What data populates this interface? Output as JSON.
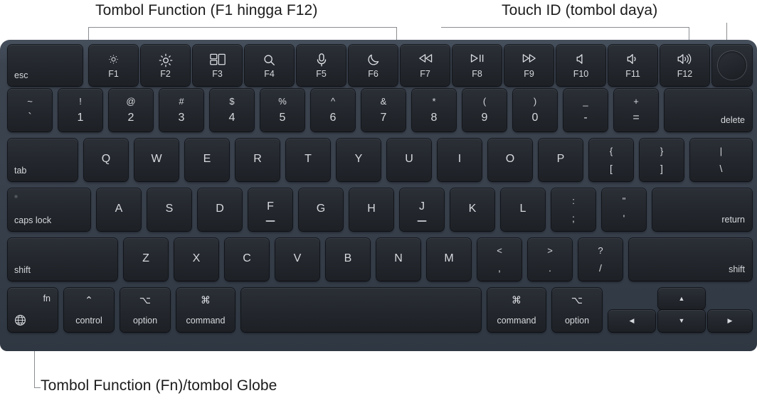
{
  "annotations": {
    "function_keys": "Tombol Function (F1 hingga F12)",
    "touch_id": "Touch ID (tombol daya)",
    "fn_globe": "Tombol Function (Fn)/tombol Globe"
  },
  "colors": {
    "chassis": "#3c4450",
    "key_face": "#25282f",
    "key_text": "#d8dade",
    "page_background": "#ffffff",
    "leader_line": "#8a8d91",
    "annotation_text": "#1b1b1b"
  },
  "keyboard": {
    "function_row": [
      {
        "name": "esc",
        "label": "esc",
        "icon": null,
        "fnum": null
      },
      {
        "name": "f1",
        "label": null,
        "icon": "brightness-down-icon",
        "fnum": "F1"
      },
      {
        "name": "f2",
        "label": null,
        "icon": "brightness-up-icon",
        "fnum": "F2"
      },
      {
        "name": "f3",
        "label": null,
        "icon": "mission-control-icon",
        "fnum": "F3"
      },
      {
        "name": "f4",
        "label": null,
        "icon": "spotlight-search-icon",
        "fnum": "F4"
      },
      {
        "name": "f5",
        "label": null,
        "icon": "dictation-microphone-icon",
        "fnum": "F5"
      },
      {
        "name": "f6",
        "label": null,
        "icon": "do-not-disturb-moon-icon",
        "fnum": "F6"
      },
      {
        "name": "f7",
        "label": null,
        "icon": "rewind-icon",
        "fnum": "F7"
      },
      {
        "name": "f8",
        "label": null,
        "icon": "play-pause-icon",
        "fnum": "F8"
      },
      {
        "name": "f9",
        "label": null,
        "icon": "fast-forward-icon",
        "fnum": "F9"
      },
      {
        "name": "f10",
        "label": null,
        "icon": "volume-mute-icon",
        "fnum": "F10"
      },
      {
        "name": "f11",
        "label": null,
        "icon": "volume-down-icon",
        "fnum": "F11"
      },
      {
        "name": "f12",
        "label": null,
        "icon": "volume-up-icon",
        "fnum": "F12"
      },
      {
        "name": "touch-id",
        "label": null,
        "icon": "touch-id-icon",
        "fnum": null
      }
    ],
    "number_row": [
      {
        "name": "backtick",
        "top": "~",
        "bottom": "`"
      },
      {
        "name": "1",
        "top": "!",
        "bottom": "1"
      },
      {
        "name": "2",
        "top": "@",
        "bottom": "2"
      },
      {
        "name": "3",
        "top": "#",
        "bottom": "3"
      },
      {
        "name": "4",
        "top": "$",
        "bottom": "4"
      },
      {
        "name": "5",
        "top": "%",
        "bottom": "5"
      },
      {
        "name": "6",
        "top": "^",
        "bottom": "6"
      },
      {
        "name": "7",
        "top": "&",
        "bottom": "7"
      },
      {
        "name": "8",
        "top": "*",
        "bottom": "8"
      },
      {
        "name": "9",
        "top": "(",
        "bottom": "9"
      },
      {
        "name": "0",
        "top": ")",
        "bottom": "0"
      },
      {
        "name": "minus",
        "top": "_",
        "bottom": "-"
      },
      {
        "name": "equals",
        "top": "+",
        "bottom": "="
      },
      {
        "name": "delete",
        "label": "delete"
      }
    ],
    "tab_row": [
      {
        "name": "tab",
        "label": "tab"
      },
      {
        "name": "q",
        "label": "Q"
      },
      {
        "name": "w",
        "label": "W"
      },
      {
        "name": "e",
        "label": "E"
      },
      {
        "name": "r",
        "label": "R"
      },
      {
        "name": "t",
        "label": "T"
      },
      {
        "name": "y",
        "label": "Y"
      },
      {
        "name": "u",
        "label": "U"
      },
      {
        "name": "i",
        "label": "I"
      },
      {
        "name": "o",
        "label": "O"
      },
      {
        "name": "p",
        "label": "P"
      },
      {
        "name": "bracket-left",
        "top": "{",
        "bottom": "["
      },
      {
        "name": "bracket-right",
        "top": "}",
        "bottom": "]"
      },
      {
        "name": "backslash",
        "top": "|",
        "bottom": "\\"
      }
    ],
    "home_row": [
      {
        "name": "caps-lock",
        "label": "caps lock"
      },
      {
        "name": "a",
        "label": "A"
      },
      {
        "name": "s",
        "label": "S"
      },
      {
        "name": "d",
        "label": "D"
      },
      {
        "name": "f",
        "label": "F",
        "homing": true
      },
      {
        "name": "g",
        "label": "G"
      },
      {
        "name": "h",
        "label": "H"
      },
      {
        "name": "j",
        "label": "J",
        "homing": true
      },
      {
        "name": "k",
        "label": "K"
      },
      {
        "name": "l",
        "label": "L"
      },
      {
        "name": "semicolon",
        "top": ":",
        "bottom": ";"
      },
      {
        "name": "quote",
        "top": "\"",
        "bottom": "'"
      },
      {
        "name": "return",
        "label": "return"
      }
    ],
    "shift_row": [
      {
        "name": "shift-left",
        "label": "shift"
      },
      {
        "name": "z",
        "label": "Z"
      },
      {
        "name": "x",
        "label": "X"
      },
      {
        "name": "c",
        "label": "C"
      },
      {
        "name": "v",
        "label": "V"
      },
      {
        "name": "b",
        "label": "B"
      },
      {
        "name": "n",
        "label": "N"
      },
      {
        "name": "m",
        "label": "M"
      },
      {
        "name": "comma",
        "top": "<",
        "bottom": ","
      },
      {
        "name": "period",
        "top": ">",
        "bottom": "."
      },
      {
        "name": "slash",
        "top": "?",
        "bottom": "/"
      },
      {
        "name": "shift-right",
        "label": "shift"
      }
    ],
    "bottom_row": [
      {
        "name": "fn",
        "label": "fn",
        "icon": "globe-icon"
      },
      {
        "name": "control-left",
        "symbol": "⌃",
        "label": "control"
      },
      {
        "name": "option-left",
        "symbol": "⌥",
        "label": "option"
      },
      {
        "name": "command-left",
        "symbol": "⌘",
        "label": "command"
      },
      {
        "name": "space",
        "label": ""
      },
      {
        "name": "command-right",
        "symbol": "⌘",
        "label": "command"
      },
      {
        "name": "option-right",
        "symbol": "⌥",
        "label": "option"
      },
      {
        "name": "arrow-left",
        "icon": "arrow-left-icon"
      },
      {
        "name": "arrow-up",
        "icon": "arrow-up-icon"
      },
      {
        "name": "arrow-down",
        "icon": "arrow-down-icon"
      },
      {
        "name": "arrow-right",
        "icon": "arrow-right-icon"
      }
    ]
  }
}
